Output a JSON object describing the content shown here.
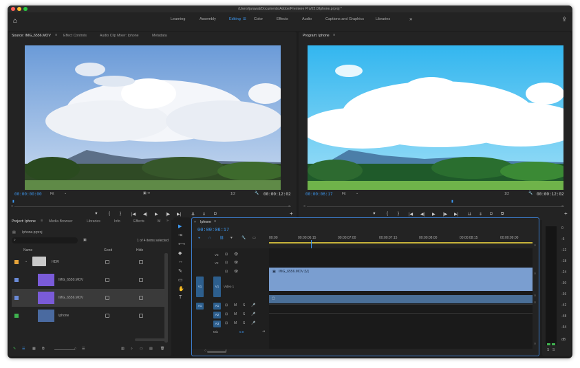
{
  "window": {
    "title": "/Users/jaruwat/Documents/Adobe/Premiere Pro/22.0/Iphone.prproj *",
    "traffic_colors": [
      "#ff5f57",
      "#febc2e",
      "#28c840"
    ]
  },
  "workspaces": {
    "tabs": [
      {
        "label": "Learning"
      },
      {
        "label": "Assembly"
      },
      {
        "label": "Editing"
      },
      {
        "label": "Color"
      },
      {
        "label": "Effects"
      },
      {
        "label": "Audio"
      },
      {
        "label": "Captions and Graphics"
      },
      {
        "label": "Libraries"
      }
    ],
    "more": "»",
    "menu_glyph": "≡"
  },
  "source_monitor": {
    "tabs": [
      "Source: IMG_6556.MOV",
      "Effect Controls",
      "Audio Clip Mixer: Iphone",
      "Metadata"
    ],
    "tab_menu": "≡",
    "timecode_in": "00:00:00:00",
    "fit": "Fit",
    "resolution": "1/2",
    "timecode_out": "00:00:12:02"
  },
  "program_monitor": {
    "tab": "Program: Iphone",
    "tab_menu": "≡",
    "timecode_in": "00:00:06:17",
    "fit": "Fit",
    "resolution": "1/2",
    "timecode_out": "00:00:12:02"
  },
  "transport": {
    "marker": "♥",
    "mark_in": "{",
    "mark_out": "}",
    "go_in": "|◀",
    "step_back": "◀|",
    "play": "▶",
    "step_fwd": "|▶",
    "go_out": "▶|",
    "insert": "⇊",
    "overwrite": "⇓",
    "export_frame": "◘",
    "add": "+"
  },
  "project_panel": {
    "tabs": [
      "Project: Iphone",
      "Media Browser",
      "Libraries",
      "Info",
      "Effects",
      "M"
    ],
    "tab_menu": "≡",
    "more": "»",
    "file": "Iphone.prproj",
    "search_placeholder": "",
    "items_count": "1 of 4 items selected",
    "columns": {
      "name": "Name",
      "good": "Good",
      "hide": "Hide"
    },
    "rows": [
      {
        "name": "HDR",
        "color": "#e7a43a",
        "kind": "bin"
      },
      {
        "name": "IMG_6550.MOV",
        "color": "#6a8ad6",
        "kind": "clip"
      },
      {
        "name": "IMG_6556.MOV",
        "color": "#6a8ad6",
        "kind": "clip"
      },
      {
        "name": "Iphone",
        "color": "#3fb34f",
        "kind": "sequence"
      }
    ]
  },
  "timeline": {
    "tab": "Iphone",
    "tab_menu": "≡",
    "close": "×",
    "timecode": "00:00:06:17",
    "ruler": [
      "00:00",
      "00:00:06:15",
      "00:00:07:00",
      "00:00:07:15",
      "00:00:08:00",
      "00:00:08:15",
      "00:00:09:00"
    ],
    "video_tracks": [
      {
        "name": "V3",
        "label": ""
      },
      {
        "name": "V2",
        "label": ""
      },
      {
        "name": "V1",
        "label": "Video 1"
      }
    ],
    "audio_tracks": [
      {
        "name": "A1"
      },
      {
        "name": "A2"
      },
      {
        "name": "A3"
      }
    ],
    "source_v": "V1",
    "source_a": "A1",
    "mix_label": "Mix",
    "mix_value": "0.0",
    "clip_label": "IMG_6556.MOV [V]",
    "toggles": {
      "m": "M",
      "s": "S",
      "mic": "🎤",
      "eye": "👁",
      "sync": "⊡"
    }
  },
  "audio_meter": {
    "scale": [
      "0",
      "-6",
      "-12",
      "-18",
      "-24",
      "-30",
      "-36",
      "-42",
      "-48",
      "-54",
      "dB"
    ],
    "solo": [
      "S",
      "S"
    ]
  },
  "tools": [
    "▶",
    "⇥",
    "⟷",
    "◆",
    "↔",
    "✎",
    "▭",
    "✋",
    "T"
  ]
}
